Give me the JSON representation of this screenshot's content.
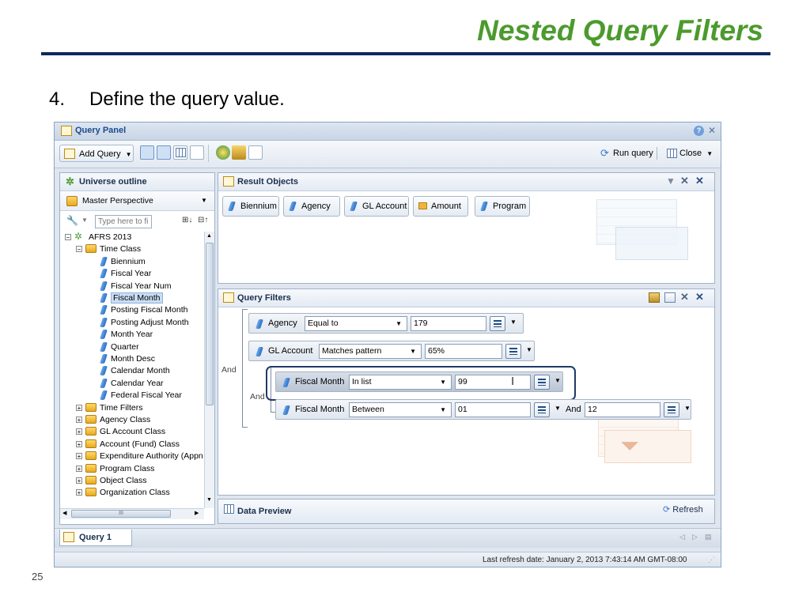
{
  "slide": {
    "title": "Nested Query Filters",
    "step_number": "4.",
    "step_text": "Define the query value.",
    "page_number": "25"
  },
  "window": {
    "title": "Query Panel",
    "toolbar": {
      "add_query": "Add Query",
      "run_query": "Run query",
      "close": "Close"
    },
    "universe_outline": {
      "title": "Universe outline",
      "perspective": "Master Perspective",
      "search_placeholder": "Type here to filte",
      "tree": [
        {
          "label": "AFRS 2013",
          "level": 0,
          "type": "universe"
        },
        {
          "label": "Time Class",
          "level": 1,
          "type": "folder-open"
        },
        {
          "label": "Biennium",
          "level": 2,
          "type": "dimension"
        },
        {
          "label": "Fiscal Year",
          "level": 2,
          "type": "dimension"
        },
        {
          "label": "Fiscal Year Num",
          "level": 2,
          "type": "dimension"
        },
        {
          "label": "Fiscal Month",
          "level": 2,
          "type": "dimension",
          "selected": true
        },
        {
          "label": "Posting Fiscal Month",
          "level": 2,
          "type": "dimension"
        },
        {
          "label": "Posting Adjust Month",
          "level": 2,
          "type": "dimension"
        },
        {
          "label": "Month Year",
          "level": 2,
          "type": "dimension"
        },
        {
          "label": "Quarter",
          "level": 2,
          "type": "dimension"
        },
        {
          "label": "Month Desc",
          "level": 2,
          "type": "dimension"
        },
        {
          "label": "Calendar Month",
          "level": 2,
          "type": "dimension"
        },
        {
          "label": "Calendar Year",
          "level": 2,
          "type": "dimension"
        },
        {
          "label": "Federal Fiscal Year",
          "level": 2,
          "type": "dimension"
        },
        {
          "label": "Time Filters",
          "level": 1,
          "type": "folder"
        },
        {
          "label": "Agency Class",
          "level": 1,
          "type": "folder"
        },
        {
          "label": "GL Account Class",
          "level": 1,
          "type": "folder"
        },
        {
          "label": "Account (Fund) Class",
          "level": 1,
          "type": "folder"
        },
        {
          "label": "Expenditure Authority (Appn",
          "level": 1,
          "type": "folder"
        },
        {
          "label": "Program Class",
          "level": 1,
          "type": "folder"
        },
        {
          "label": "Object Class",
          "level": 1,
          "type": "folder"
        },
        {
          "label": "Organization Class",
          "level": 1,
          "type": "folder"
        }
      ],
      "hscroll_label": "III"
    },
    "result_objects": {
      "title": "Result Objects",
      "items": [
        "Biennium",
        "Agency",
        "GL Account",
        "Amount",
        "Program"
      ]
    },
    "query_filters": {
      "title": "Query Filters",
      "outer_operator": "And",
      "inner_operator": "And",
      "rows": [
        {
          "object": "Agency",
          "operator": "Equal to",
          "value": "179"
        },
        {
          "object": "GL Account",
          "operator": "Matches pattern",
          "value": "65%"
        },
        {
          "object": "Fiscal Month",
          "operator": "In list",
          "value": "99"
        },
        {
          "object": "Fiscal Month",
          "operator": "Between",
          "value": "01",
          "and_label": "And",
          "value2": "12"
        }
      ]
    },
    "data_preview": {
      "title": "Data Preview",
      "refresh": "Refresh"
    },
    "tab": "Query 1",
    "status": "Last refresh date: January 2, 2013 7:43:14 AM GMT-08:00"
  }
}
